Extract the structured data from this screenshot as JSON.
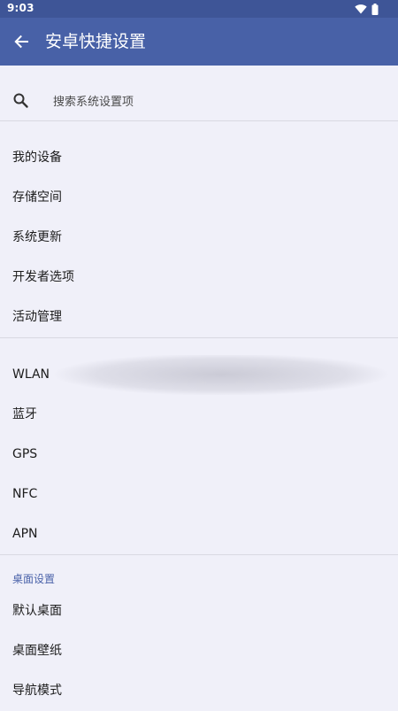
{
  "status_bar": {
    "time": "9:03",
    "icons": [
      "wifi-icon",
      "battery-icon"
    ]
  },
  "app_bar": {
    "back_icon": "arrow-left-icon",
    "title": "安卓快捷设置"
  },
  "search": {
    "icon": "search-icon",
    "placeholder": "搜索系统设置项",
    "value": ""
  },
  "group1": {
    "items": [
      "我的设备",
      "存储空间",
      "系统更新",
      "开发者选项",
      "活动管理"
    ]
  },
  "group2": {
    "items": [
      "WLAN",
      "蓝牙",
      "GPS",
      "NFC",
      "APN"
    ]
  },
  "group3": {
    "header": "桌面设置",
    "items": [
      "默认桌面",
      "桌面壁纸",
      "导航模式"
    ]
  },
  "colors": {
    "status_bar": "#3e5597",
    "app_bar": "#4861a7",
    "background": "#f0f0f9",
    "accent": "#4b63aa"
  }
}
